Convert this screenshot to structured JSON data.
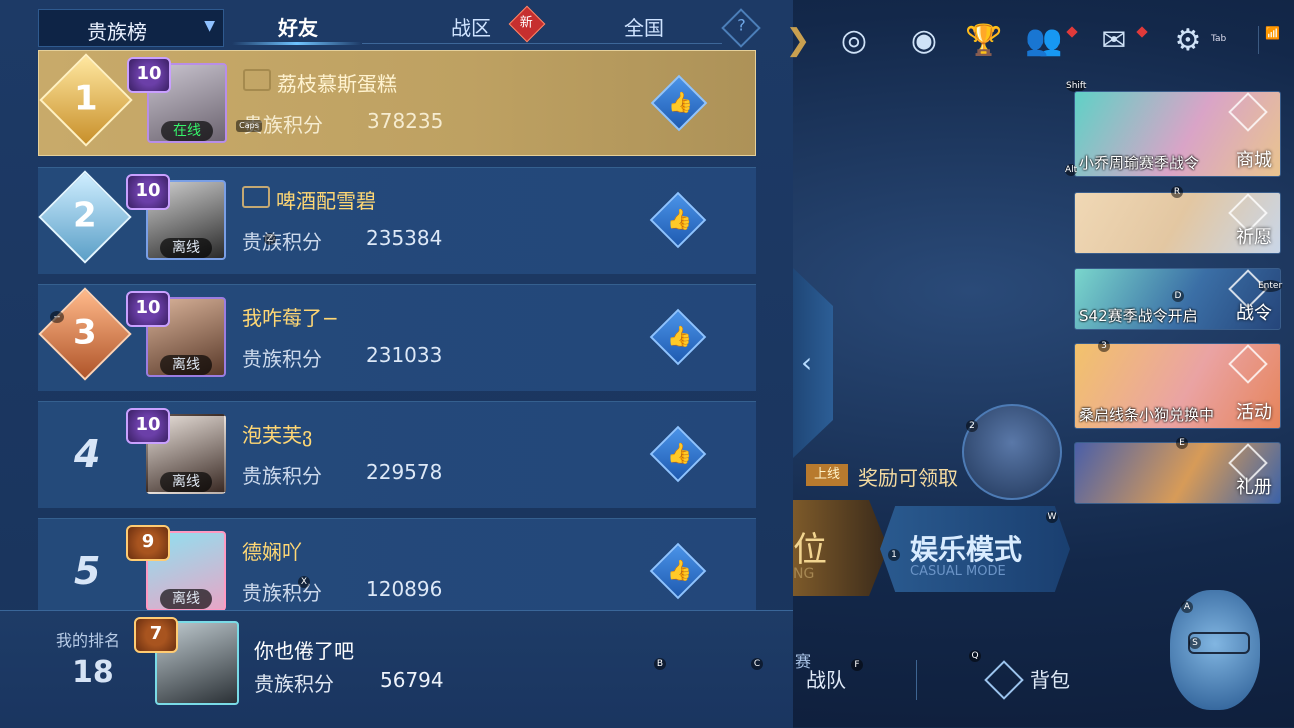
{
  "leaderboard": {
    "dropdown_label": "贵族榜",
    "tabs": [
      {
        "label": "好友",
        "active": true
      },
      {
        "label": "战区",
        "active": false,
        "badge": "新"
      },
      {
        "label": "全国",
        "active": false
      }
    ],
    "help_label": "?",
    "score_label": "贵族积分",
    "rows": [
      {
        "rank": "1",
        "vip": "10",
        "status": "在线",
        "name": "荔枝慕斯蛋糕",
        "score": "378235",
        "online": true,
        "guild_icon": true
      },
      {
        "rank": "2",
        "vip": "10",
        "status": "离线",
        "name": "啤酒配雪碧",
        "score": "235384",
        "online": false,
        "guild_icon": true
      },
      {
        "rank": "3",
        "vip": "10",
        "status": "离线",
        "name": "我咋莓了−",
        "score": "231033",
        "online": false,
        "guild_icon": false
      },
      {
        "rank": "4",
        "vip": "10",
        "status": "离线",
        "name": "泡芙芙ვ",
        "score": "229578",
        "online": false,
        "guild_icon": false
      },
      {
        "rank": "5",
        "vip": "9",
        "status": "离线",
        "name": "德娴吖",
        "score": "120896",
        "online": false,
        "guild_icon": false
      }
    ],
    "mine": {
      "label": "我的排名",
      "rank": "18",
      "vip": "7",
      "name": "你也倦了吧",
      "score": "56794"
    }
  },
  "lobby": {
    "top_icons": [
      "wing-icon",
      "target-icon",
      "eye-icon",
      "trophy-icon",
      "friends-icon",
      "mail-icon",
      "gear-icon",
      "wifi-icon"
    ],
    "tab_key": "Tab",
    "side_cards": [
      {
        "caption": "小乔周瑜赛季战令",
        "label": "商城",
        "key": "Alt",
        "key2": "Shift"
      },
      {
        "caption": "",
        "label": "祈愿",
        "key": "R"
      },
      {
        "caption": "S42赛季战令开启",
        "label": "战令",
        "key": "D",
        "key2": "Enter"
      },
      {
        "caption": "桑启线条小狗兑换中",
        "label": "活动",
        "key": "3"
      },
      {
        "caption": "",
        "label": "礼册",
        "key": "E"
      }
    ],
    "reward_tag": "上线",
    "reward_text": "奖励可领取",
    "mode_left_title": "位",
    "mode_left_sub": "NG",
    "mode_title": "娱乐模式",
    "mode_sub": "CASUAL MODE",
    "bottom": {
      "team": "战队",
      "team_prefix": "赛",
      "bag": "背包"
    },
    "keys": {
      "caps": "Caps",
      "z": "Z",
      "dash": "--",
      "x": "X",
      "b": "B",
      "c": "C",
      "f": "F",
      "q": "Q",
      "a": "A",
      "s": "S",
      "w": "W",
      "one": "1",
      "two": "2"
    },
    "colors": {
      "accent": "#6fc3ff",
      "gold": "#ffd774",
      "online": "#36f36a",
      "badge_red": "#c62f2f"
    }
  }
}
